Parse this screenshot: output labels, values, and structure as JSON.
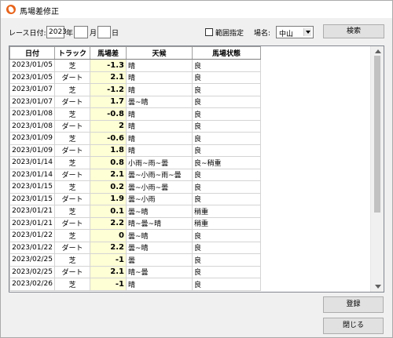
{
  "window": {
    "title": "馬場差修正"
  },
  "filters": {
    "race_date_label": "レース日付:",
    "year_value": "2023",
    "year_suffix": "年",
    "month_value": "",
    "month_suffix": "月",
    "day_value": "",
    "day_suffix": "日",
    "range_label": "範囲指定",
    "range_checked": false,
    "venue_label": "場名:",
    "venue_value": "中山",
    "search_label": "検索"
  },
  "table": {
    "columns": [
      "日付",
      "トラック",
      "馬場差",
      "天候",
      "馬場状態"
    ],
    "rows": [
      [
        "2023/01/05",
        "芝",
        "-1.3",
        "晴",
        "良"
      ],
      [
        "2023/01/05",
        "ダート",
        "2.1",
        "晴",
        "良"
      ],
      [
        "2023/01/07",
        "芝",
        "-1.2",
        "晴",
        "良"
      ],
      [
        "2023/01/07",
        "ダート",
        "1.7",
        "曇~晴",
        "良"
      ],
      [
        "2023/01/08",
        "芝",
        "-0.8",
        "晴",
        "良"
      ],
      [
        "2023/01/08",
        "ダート",
        "2",
        "晴",
        "良"
      ],
      [
        "2023/01/09",
        "芝",
        "-0.6",
        "晴",
        "良"
      ],
      [
        "2023/01/09",
        "ダート",
        "1.8",
        "晴",
        "良"
      ],
      [
        "2023/01/14",
        "芝",
        "0.8",
        "小雨~雨~曇",
        "良~稍重"
      ],
      [
        "2023/01/14",
        "ダート",
        "2.1",
        "曇~小雨~雨~曇",
        "良"
      ],
      [
        "2023/01/15",
        "芝",
        "0.2",
        "曇~小雨~曇",
        "良"
      ],
      [
        "2023/01/15",
        "ダート",
        "1.9",
        "曇~小雨",
        "良"
      ],
      [
        "2023/01/21",
        "芝",
        "0.1",
        "曇~晴",
        "稍重"
      ],
      [
        "2023/01/21",
        "ダート",
        "2.2",
        "晴~曇~晴",
        "稍重"
      ],
      [
        "2023/01/22",
        "芝",
        "0",
        "曇~晴",
        "良"
      ],
      [
        "2023/01/22",
        "ダート",
        "2.2",
        "曇~晴",
        "良"
      ],
      [
        "2023/02/25",
        "芝",
        "-1",
        "曇",
        "良"
      ],
      [
        "2023/02/25",
        "ダート",
        "2.1",
        "晴~曇",
        "良"
      ],
      [
        "2023/02/26",
        "芝",
        "-1",
        "晴",
        "良"
      ]
    ]
  },
  "buttons": {
    "register_label": "登録",
    "close_label": "閉じる"
  }
}
